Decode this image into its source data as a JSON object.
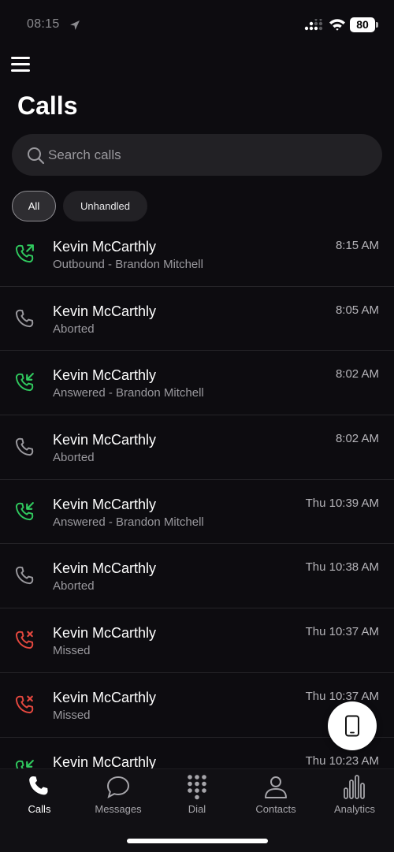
{
  "status_bar": {
    "time": "08:15",
    "battery": "80"
  },
  "header": {
    "title": "Calls"
  },
  "search": {
    "placeholder": "Search calls"
  },
  "filters": [
    {
      "label": "All",
      "selected": true
    },
    {
      "label": "Unhandled",
      "selected": false
    }
  ],
  "colors": {
    "outbound": "#30c95e",
    "answered": "#30c95e",
    "missed": "#e5483f",
    "aborted": "#9a999e"
  },
  "calls": [
    {
      "name": "Kevin McCarthly",
      "detail": "Outbound - Brandon Mitchell",
      "time": "8:15 AM",
      "type": "outbound",
      "icon": "phone-outgoing-icon"
    },
    {
      "name": "Kevin McCarthly",
      "detail": "Aborted",
      "time": "8:05 AM",
      "type": "aborted",
      "icon": "phone-icon"
    },
    {
      "name": "Kevin McCarthly",
      "detail": "Answered - Brandon Mitchell",
      "time": "8:02 AM",
      "type": "answered",
      "icon": "phone-incoming-icon"
    },
    {
      "name": "Kevin McCarthly",
      "detail": "Aborted",
      "time": "8:02 AM",
      "type": "aborted",
      "icon": "phone-icon"
    },
    {
      "name": "Kevin McCarthly",
      "detail": "Answered - Brandon Mitchell",
      "time": "Thu 10:39 AM",
      "type": "answered",
      "icon": "phone-incoming-icon"
    },
    {
      "name": "Kevin McCarthly",
      "detail": "Aborted",
      "time": "Thu 10:38 AM",
      "type": "aborted",
      "icon": "phone-icon"
    },
    {
      "name": "Kevin McCarthly",
      "detail": "Missed",
      "time": "Thu 10:37 AM",
      "type": "missed",
      "icon": "phone-missed-icon"
    },
    {
      "name": "Kevin McCarthly",
      "detail": "Missed",
      "time": "Thu 10:37 AM",
      "type": "missed",
      "icon": "phone-missed-icon"
    },
    {
      "name": "Kevin McCarthly",
      "detail": "",
      "time": "Thu 10:23 AM",
      "type": "answered",
      "icon": "phone-incoming-icon"
    }
  ],
  "tabs": [
    {
      "label": "Calls",
      "icon": "phone-icon",
      "active": true
    },
    {
      "label": "Messages",
      "icon": "chat-bubble-icon",
      "active": false
    },
    {
      "label": "Dial",
      "icon": "dialpad-icon",
      "active": false
    },
    {
      "label": "Contacts",
      "icon": "person-icon",
      "active": false
    },
    {
      "label": "Analytics",
      "icon": "bar-chart-icon",
      "active": false
    }
  ]
}
